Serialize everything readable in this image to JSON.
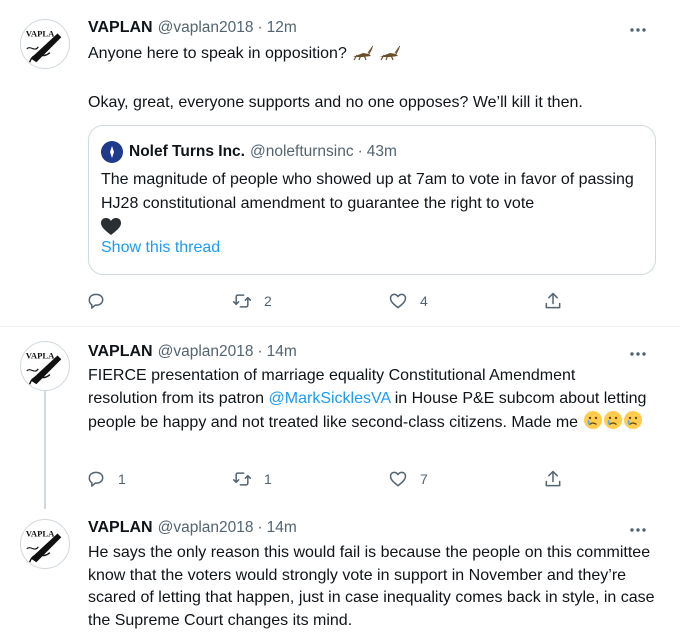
{
  "tweets": [
    {
      "name": "VAPLAN",
      "handle": "@vaplan2018",
      "sep": "·",
      "time": "12m",
      "line1": "Anyone here to speak in opposition?",
      "line2": "Okay, great, everyone supports and no one opposes? We’ll kill it then.",
      "quote": {
        "name": "Nolef Turns Inc.",
        "handle": "@nolefturnsinc",
        "sep": "·",
        "time": "43m",
        "text": "The magnitude of people who showed up at 7am to vote in favor of passing HJ28 constitutional amendment to guarantee the right to vote",
        "link": "Show this thread"
      },
      "replies": "",
      "retweets": "2",
      "likes": "4"
    },
    {
      "name": "VAPLAN",
      "handle": "@vaplan2018",
      "sep": "·",
      "time": "14m",
      "text_a": "FIERCE presentation of marriage equality Constitutional Amendment resolution from its patron ",
      "mention": "@MarkSicklesVA",
      "text_b": " in House P&E subcom about letting people be happy and not treated like second-class citizens. Made me ",
      "replies": "1",
      "retweets": "1",
      "likes": "7"
    },
    {
      "name": "VAPLAN",
      "handle": "@vaplan2018",
      "sep": "·",
      "time": "14m",
      "text": "He says the only reason this would fail is because the people on this committee know that the voters would strongly vote in support in November and they’re scared of letting that happen, just in case inequality comes back in style, in case the Supreme Court changes its mind."
    }
  ],
  "icons": {
    "avatar": "vaplan-logo-icon",
    "more": "more-icon",
    "reply": "reply-icon",
    "retweet": "retweet-icon",
    "like": "like-icon",
    "share": "share-icon",
    "cricket": "cricket-icon",
    "heart": "black-heart-icon",
    "crying": "crying-face-icon"
  },
  "colors": {
    "link": "#1d9bf0",
    "secondary": "#536471",
    "border": "#cfd9de"
  }
}
